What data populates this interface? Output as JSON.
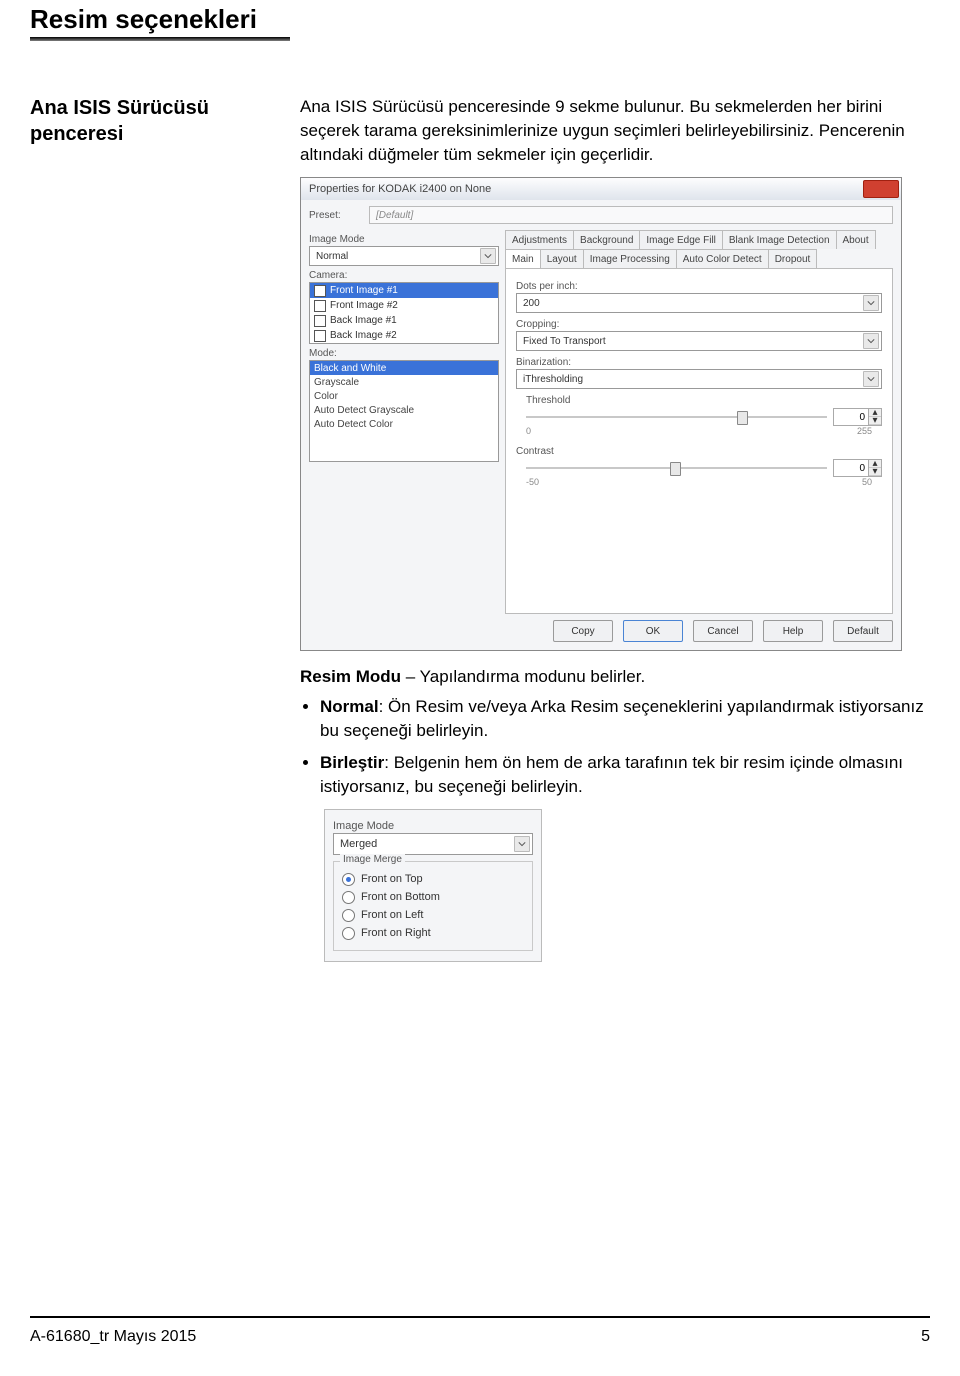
{
  "page": {
    "heading": "Resim seçenekleri",
    "section_title_line1": "Ana ISIS Sürücüsü",
    "section_title_line2": "penceresi",
    "intro": "Ana ISIS Sürücüsü penceresinde 9 sekme bulunur. Bu sekmelerden her birini seçerek tarama gereksinimlerinize uygun seçimleri belirleyebilirsiniz. Pencerenin altındaki düğmeler tüm sekmeler için geçerlidir.",
    "resim_modu_label": "Resim Modu",
    "resim_modu_text": " – Yapılandırma modunu belirler.",
    "bullet_normal_label": "Normal",
    "bullet_normal_text": ": Ön Resim ve/veya Arka Resim seçeneklerini yapılandırmak istiyorsanız bu seçeneği belirleyin.",
    "bullet_birlestir_label": "Birleştir",
    "bullet_birlestir_text": ": Belgenin hem ön hem de arka tarafının tek bir resim içinde olmasını istiyorsanız, bu seçeneği belirleyin."
  },
  "dialog": {
    "title": "Properties for KODAK i2400 on None",
    "preset_label": "Preset:",
    "preset_value": "[Default]",
    "image_mode_label": "Image Mode",
    "image_mode_value": "Normal",
    "camera_label": "Camera:",
    "camera_items": [
      "Front Image #1",
      "Front Image #2",
      "Back Image #1",
      "Back Image #2"
    ],
    "mode_label": "Mode:",
    "mode_items": [
      "Black and White",
      "Grayscale",
      "Color",
      "Auto Detect Grayscale",
      "Auto Detect Color"
    ],
    "tabs_top": [
      "Adjustments",
      "Background",
      "Image Edge Fill",
      "Blank Image Detection",
      "About"
    ],
    "tabs_bottom": [
      "Main",
      "Layout",
      "Image Processing",
      "Auto Color Detect",
      "Dropout"
    ],
    "dpi_label": "Dots per inch:",
    "dpi_value": "200",
    "cropping_label": "Cropping:",
    "cropping_value": "Fixed To Transport",
    "binarization_label": "Binarization:",
    "binarization_value": "iThresholding",
    "threshold_label": "Threshold",
    "threshold_value": "0",
    "threshold_min": "0",
    "threshold_max": "255",
    "contrast_label": "Contrast",
    "contrast_value": "0",
    "contrast_min": "-50",
    "contrast_max": "50",
    "buttons": {
      "copy": "Copy",
      "ok": "OK",
      "cancel": "Cancel",
      "help": "Help",
      "default": "Default"
    }
  },
  "merged_panel": {
    "image_mode_label": "Image Mode",
    "image_mode_value": "Merged",
    "group_title": "Image Merge",
    "options": [
      "Front on Top",
      "Front on Bottom",
      "Front on Left",
      "Front on Right"
    ]
  },
  "footer": {
    "left": "A-61680_tr  Mayıs 2015",
    "right": "5"
  }
}
